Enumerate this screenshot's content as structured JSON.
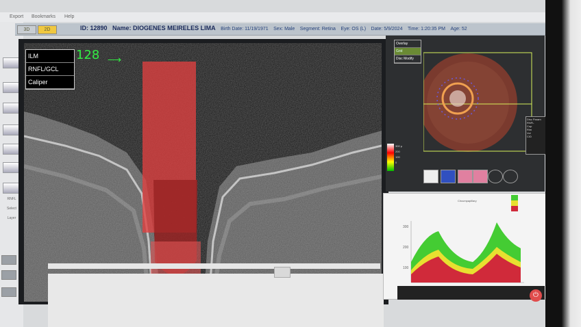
{
  "menu": {
    "items": [
      "Export",
      "Bookmarks",
      "Help"
    ]
  },
  "window": {
    "close_glyph": "×"
  },
  "toolbar": {
    "mode_tabs": [
      "3D",
      "2D"
    ],
    "labels": [
      "RNFL",
      "Select",
      "Layer"
    ]
  },
  "patient": {
    "id": "ID: 12890",
    "name": "Name: DIOGENES MEIRELES LIMA",
    "birth_date": "Birth Date: 11/19/1971",
    "sex": "Sex: Male",
    "segment": "Segment: Retina",
    "eye": "Eye: OS (L)",
    "date": "Date: 5/9/2024",
    "time": "Time: 1:20:35 PM",
    "age": "Age: 52"
  },
  "bscan": {
    "slice_number": "128",
    "arrow": "⟶",
    "layers": [
      "ILM",
      "RNFL/GCL",
      "Caliper"
    ]
  },
  "fundus": {
    "view_menu": [
      "Overlay",
      "Grid",
      "Disc Modify"
    ],
    "active_view": "Grid",
    "scale_labels": [
      "300 μ",
      "200",
      "100",
      "0"
    ],
    "stats_labels": [
      "Disc Param",
      "RNFL",
      "Cup",
      "Rim",
      "Vol",
      "C/D"
    ]
  },
  "chart": {
    "title": "Circumpapillary",
    "y_ticks": [
      "300",
      "200",
      "100"
    ],
    "legend": [
      "Normal",
      "Border",
      "Outside"
    ]
  },
  "colors": {
    "accent_green": "#33ee44",
    "overlay_red": "#e04040",
    "header_blue": "#1a2a5a"
  },
  "icons": [
    "close-icon",
    "power-icon",
    "arrow-right-icon",
    "chart-icon",
    "circle-icon"
  ]
}
